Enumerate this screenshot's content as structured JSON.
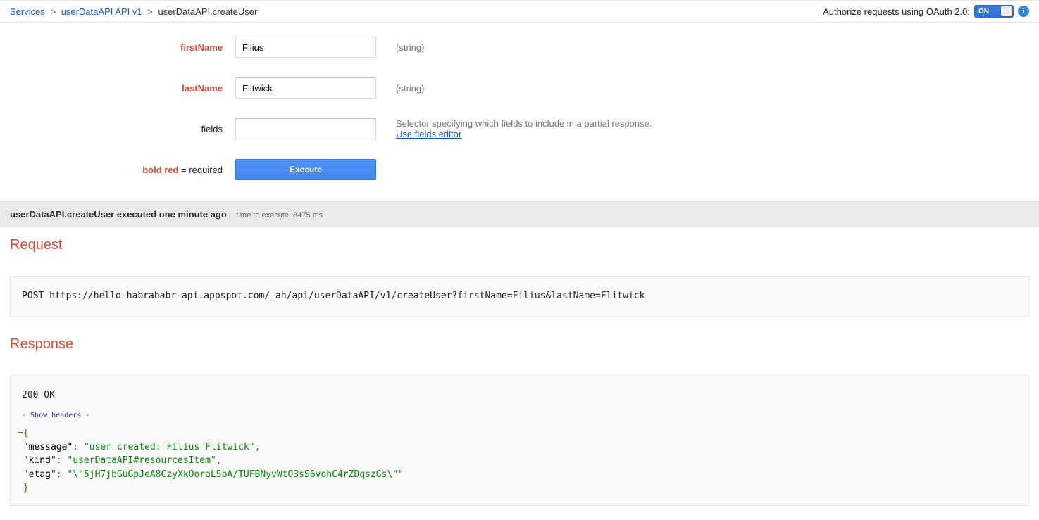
{
  "breadcrumb": {
    "services": "Services",
    "api": "userDataAPI API v1",
    "method": "userDataAPI.createUser"
  },
  "auth": {
    "label": "Authorize requests using OAuth 2.0:",
    "toggle": "ON"
  },
  "form": {
    "firstName": {
      "label": "firstName",
      "value": "Filius",
      "type": "(string)"
    },
    "lastName": {
      "label": "lastName",
      "value": "Flitwick",
      "type": "(string)"
    },
    "fields": {
      "label": "fields",
      "value": "",
      "desc": "Selector specifying which fields to include in a partial response.",
      "editor": "Use fields editor"
    },
    "required_prefix": "bold red",
    "required_suffix": " = required",
    "execute": "Execute"
  },
  "status": {
    "main": "userDataAPI.createUser executed one minute ago",
    "sub": "time to execute: 8475 ms"
  },
  "request": {
    "title": "Request",
    "body": "POST https://hello-habrahabr-api.appspot.com/_ah/api/userDataAPI/v1/createUser?firstName=Filius&lastName=Flitwick"
  },
  "response": {
    "title": "Response",
    "status": "200 OK",
    "show_headers": "- Show headers -",
    "json": {
      "message_key": "\"message\"",
      "message_val": "\"user created: Filius Flitwick\"",
      "kind_key": "\"kind\"",
      "kind_val": "\"userDataAPI#resourcesItem\"",
      "etag_key": "\"etag\"",
      "etag_val": "\"\\\"5jH7jbGuGpJeA8CzyXkOoraLSbA/TUFBNyvWtO3sS6vohC4rZDqszGs\\\"\""
    }
  }
}
